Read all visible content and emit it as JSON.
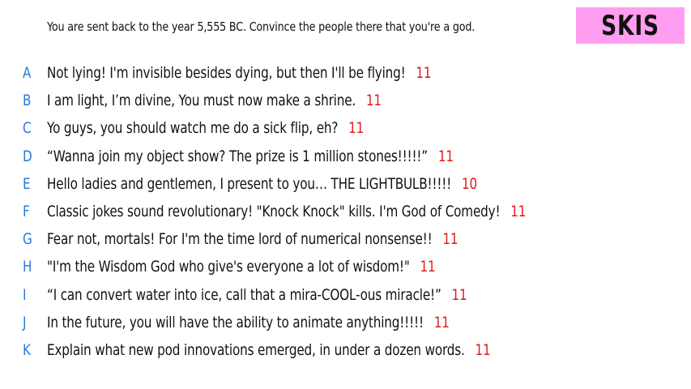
{
  "prompt": "You are sent back to the year 5,555 BC. Convince the people there that you're a god.",
  "badge": "SKIS",
  "colors": {
    "letter": "#2979d9",
    "score": "#e01b1b",
    "badge_bg": "#ff9ef0"
  },
  "answers": [
    {
      "letter": "A",
      "text": "Not lying! I'm invisible besides dying, but then I'll be flying!",
      "score": "11"
    },
    {
      "letter": "B",
      "text": "I am light, I’m divine, You must now make a shrine.",
      "score": "11"
    },
    {
      "letter": "C",
      "text": "Yo guys, you should watch me do a sick flip, eh?",
      "score": "11"
    },
    {
      "letter": "D",
      "text": "“Wanna join my object show? The prize is 1 million stones!!!!!”",
      "score": "11"
    },
    {
      "letter": "E",
      "text": "Hello ladies and gentlemen, I present to you… THE LIGHTBULB!!!!!",
      "score": "10"
    },
    {
      "letter": "F",
      "text": "Classic jokes sound revolutionary! \"Knock Knock\" kills. I'm God of Comedy!",
      "score": "11"
    },
    {
      "letter": "G",
      "text": "Fear not, mortals! For I'm the time lord of numerical nonsense!!",
      "score": "11"
    },
    {
      "letter": "H",
      "text": "\"I'm the Wisdom God who give's everyone a lot of wisdom!\"",
      "score": "11"
    },
    {
      "letter": "I",
      "text": "“I can convert water into ice, call that a mira-COOL-ous miracle!”",
      "score": "11"
    },
    {
      "letter": "J",
      "text": "In the future, you will have the ability to animate anything!!!!!",
      "score": "11"
    },
    {
      "letter": "K",
      "text": "Explain what new pod innovations emerged, in under a dozen words.",
      "score": "11"
    }
  ]
}
